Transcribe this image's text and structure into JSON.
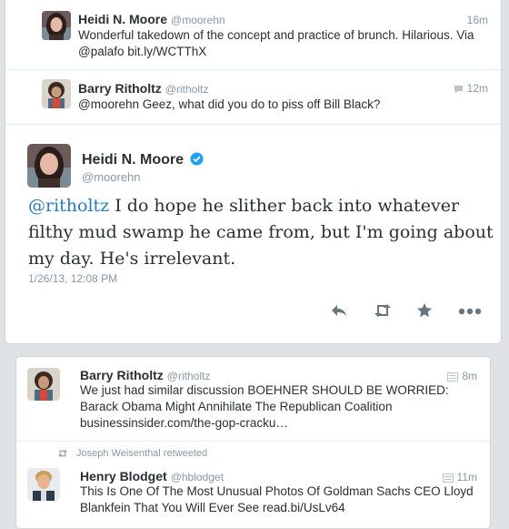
{
  "colors": {
    "link": "#2b7bb9",
    "verified": "#1da1f2",
    "muted": "#8899a6",
    "background": "#dfe3e6"
  },
  "top_card": {
    "tweet1": {
      "name": "Heidi N. Moore",
      "handle": "@moorehn",
      "time": "16m",
      "text_line1": "Wonderful takedown of the concept and practice of brunch. Hilarious. Via",
      "text_line2": "@palafo bit.ly/WCTThX"
    },
    "tweet2": {
      "name": "Barry Ritholtz",
      "handle": "@ritholtz",
      "time_icon": "conversation-icon",
      "time": "12m",
      "text": "@moorehn Geez, what did you do to piss off Bill Black?"
    },
    "focus": {
      "name": "Heidi N. Moore",
      "handle": "@moorehn",
      "verified_icon": "verified-badge-icon",
      "mention": "@ritholtz",
      "text": " I do hope he slither back into whatever filthy mud swamp he came from, but I'm going about my day. He's irrelevant.",
      "timestamp": "1/26/13, 12:08 PM",
      "actions": [
        "reply-icon",
        "retweet-icon",
        "favorite-icon",
        "more-icon"
      ]
    }
  },
  "bottom_card": {
    "tweet1": {
      "name": "Barry Ritholtz",
      "handle": "@ritholtz",
      "time_icon": "card-icon",
      "time": "8m",
      "text_line1": "We just had similar discussion BOEHNER SHOULD BE WORRIED:",
      "text_line2": "Barack Obama Might Annihilate The Republican Coalition",
      "text_line3": "businessinsider.com/the-gop-cracku…"
    },
    "retweet_context": "Joseph Weisenthal retweeted",
    "tweet2": {
      "name": "Henry Blodget",
      "handle": "@hblodget",
      "time_icon": "card-icon",
      "time": "11m",
      "text_line1": "This Is One Of The Most Unusual Photos Of Goldman Sachs CEO Lloyd",
      "text_line2": "Blankfein That You Will Ever See read.bi/UsLv64"
    }
  }
}
